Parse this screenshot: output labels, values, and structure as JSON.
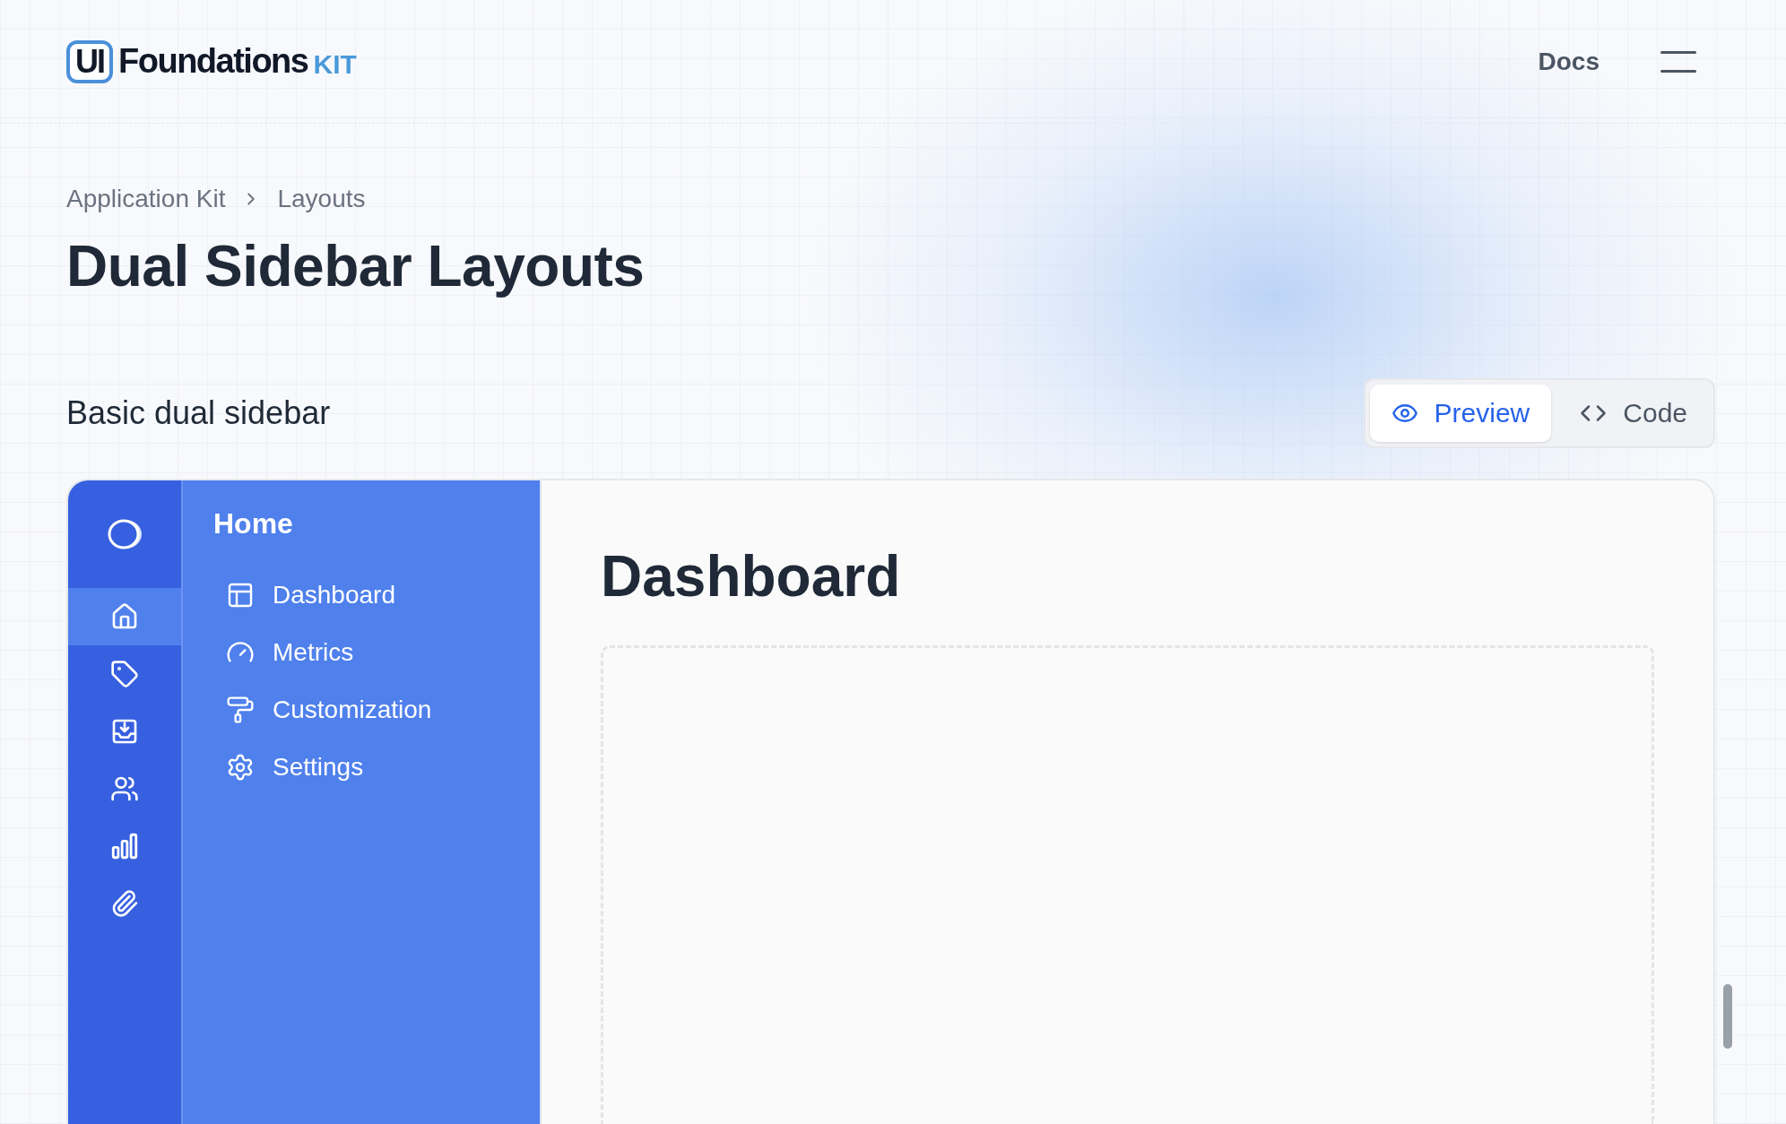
{
  "header": {
    "logo": {
      "badge": "UI",
      "name": "Foundations",
      "suffix": "KIT"
    },
    "nav_link": "Docs"
  },
  "breadcrumb": [
    "Application Kit",
    "Layouts"
  ],
  "title": "Dual Sidebar Layouts",
  "section": {
    "title": "Basic dual sidebar",
    "tabs": [
      {
        "label": "Preview",
        "selected": true
      },
      {
        "label": "Code",
        "selected": false
      }
    ]
  },
  "preview": {
    "rail": [
      {
        "selected": true
      },
      {
        "selected": false
      },
      {
        "selected": false
      },
      {
        "selected": false
      },
      {
        "selected": false
      },
      {
        "selected": false
      }
    ],
    "sidebar": {
      "heading": "Home",
      "items": [
        {
          "label": "Dashboard"
        },
        {
          "label": "Metrics"
        },
        {
          "label": "Customization"
        },
        {
          "label": "Settings"
        }
      ]
    },
    "content": {
      "heading": "Dashboard"
    }
  }
}
